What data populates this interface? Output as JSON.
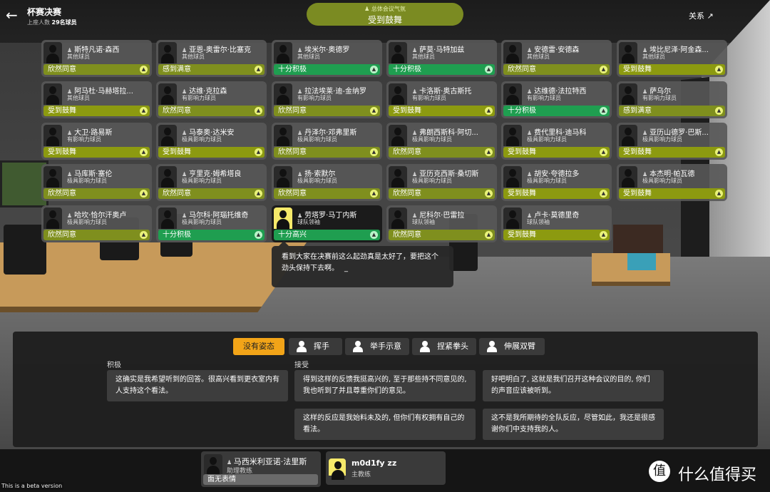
{
  "header": {
    "back_icon": "arrow-left-icon",
    "title": "杯赛决赛",
    "attendance_label": "上座人数",
    "attendance_value": "29名球员",
    "mood_label": "总体会议气氛",
    "mood_value": "受到鼓舞",
    "close_label": "关系"
  },
  "players": [
    {
      "name": "斯特凡诺·森西",
      "role": "其他球员",
      "status": "欣然同意",
      "tone": "pleased"
    },
    {
      "name": "亚恩-奥雷尔·比塞克",
      "role": "其他球员",
      "status": "感到满意",
      "tone": "happy"
    },
    {
      "name": "埃米尔·奥德罗",
      "role": "其他球员",
      "status": "十分积极",
      "tone": "very"
    },
    {
      "name": "萨莫·马特加兹",
      "role": "其他球员",
      "status": "十分积极",
      "tone": "very"
    },
    {
      "name": "安德雷·安德森",
      "role": "其他球员",
      "status": "欣然同意",
      "tone": "pleased"
    },
    {
      "name": "埃比尼泽·阿金森...",
      "role": "其他球员",
      "status": "受到鼓舞",
      "tone": "excited"
    },
    {
      "name": "阿马杜·马赫塔拉...",
      "role": "其他球员",
      "status": "受到鼓舞",
      "tone": "excited"
    },
    {
      "name": "达维·克拉森",
      "role": "有影响力球员",
      "status": "欣然同意",
      "tone": "pleased"
    },
    {
      "name": "拉法埃莱·迪-金纳罗",
      "role": "有影响力球员",
      "status": "欣然同意",
      "tone": "pleased"
    },
    {
      "name": "卡洛斯·奥古斯托",
      "role": "有影响力球员",
      "status": "受到鼓舞",
      "tone": "excited"
    },
    {
      "name": "达维德·法拉特西",
      "role": "有影响力球员",
      "status": "十分积极",
      "tone": "very"
    },
    {
      "name": "萨乌尔",
      "role": "有影响力球员",
      "status": "感到满意",
      "tone": "happy"
    },
    {
      "name": "大卫·路易斯",
      "role": "有影响力球员",
      "status": "受到鼓舞",
      "tone": "excited"
    },
    {
      "name": "马泰奥·达米安",
      "role": "极具影响力球员",
      "status": "受到鼓舞",
      "tone": "excited"
    },
    {
      "name": "丹泽尔·邓弗里斯",
      "role": "极具影响力球员",
      "status": "欣然同意",
      "tone": "pleased"
    },
    {
      "name": "弗朗西斯科·阿切...",
      "role": "极具影响力球员",
      "status": "欣然同意",
      "tone": "pleased"
    },
    {
      "name": "费代里科·迪马科",
      "role": "极具影响力球员",
      "status": "受到鼓舞",
      "tone": "excited"
    },
    {
      "name": "亚历山德罗·巴斯...",
      "role": "极具影响力球员",
      "status": "受到鼓舞",
      "tone": "excited"
    },
    {
      "name": "马库斯·塞伦",
      "role": "极具影响力球员",
      "status": "欣然同意",
      "tone": "pleased"
    },
    {
      "name": "亨里克·姆希塔良",
      "role": "极具影响力球员",
      "status": "欣然同意",
      "tone": "pleased"
    },
    {
      "name": "扬·索默尔",
      "role": "极具影响力球员",
      "status": "欣然同意",
      "tone": "pleased"
    },
    {
      "name": "亚历克西斯·桑切斯",
      "role": "极具影响力球员",
      "status": "欣然同意",
      "tone": "pleased"
    },
    {
      "name": "胡安·夸德拉多",
      "role": "极具影响力球员",
      "status": "受到鼓舞",
      "tone": "excited"
    },
    {
      "name": "本杰明·帕瓦德",
      "role": "极具影响力球员",
      "status": "受到鼓舞",
      "tone": "excited"
    },
    {
      "name": "哈坎·恰尔汗奥卢",
      "role": "极具影响力球员",
      "status": "欣然同意",
      "tone": "pleased"
    },
    {
      "name": "马尔科·阿瑙托维奇",
      "role": "极具影响力球员",
      "status": "十分积极",
      "tone": "very"
    },
    {
      "name": "劳塔罗·马丁内斯",
      "role": "球队领袖",
      "status": "十分高兴",
      "tone": "very",
      "highlight": true
    },
    {
      "name": "尼科尔·巴雷拉",
      "role": "球队领袖",
      "status": "欣然同意",
      "tone": "pleased"
    },
    {
      "name": "卢卡·莫德里奇",
      "role": "球队领袖",
      "status": "受到鼓舞",
      "tone": "excited"
    }
  ],
  "bubble": {
    "text": "看到大家在决赛前这么起劲真是太好了，要把这个劲头保持下去啊。",
    "caret": "_"
  },
  "tabs": [
    {
      "label": "没有姿态",
      "icon": ""
    },
    {
      "label": "挥手",
      "icon": "wave-hand-icon"
    },
    {
      "label": "举手示意",
      "icon": "raise-hand-icon"
    },
    {
      "label": "捏紧拳头",
      "icon": "clench-fist-icon"
    },
    {
      "label": "伸展双臂",
      "icon": "spread-arms-icon"
    }
  ],
  "groups": {
    "positive": "积极",
    "accept": "接受"
  },
  "responses": [
    "这确实是我希望听到的回答。很高兴看到更衣室内有人支持这个看法。",
    "得到这样的反馈我挺高兴的, 至于那些持不同意见的, 我也听到了并且尊重你们的意见。",
    "好吧明白了, 这就是我们召开这种会议的目的, 你们的声音应该被听到。",
    "这样的反应是我始料未及的, 但你们有权拥有自己的看法。",
    "这不是我所期待的全队反应，尽管如此，我还是很感谢你们中支持我的人。"
  ],
  "staff": [
    {
      "name": "马西米利亚诺·法里斯",
      "role": "助理教练",
      "status": "面无表情"
    },
    {
      "name": "m0d1fy zz",
      "role": "主教练"
    }
  ],
  "beta_label": "This is a beta version",
  "watermark": {
    "icon": "值",
    "text": "什么值得买"
  }
}
